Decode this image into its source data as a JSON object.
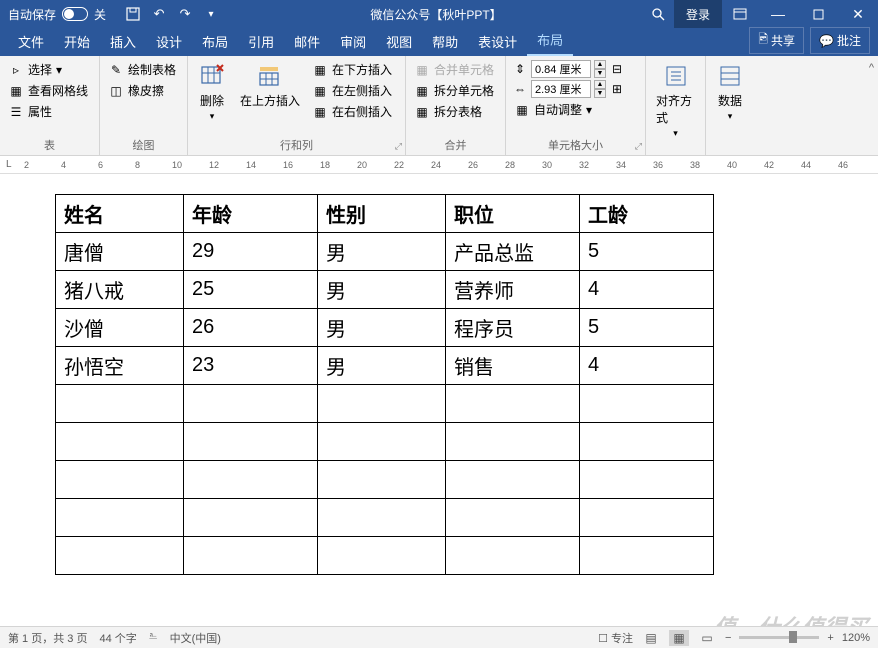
{
  "titlebar": {
    "autosave": "自动保存",
    "autosave_state": "关",
    "title": "微信公众号【秋叶PPT】",
    "login": "登录"
  },
  "tabs": {
    "items": [
      "文件",
      "开始",
      "插入",
      "设计",
      "布局",
      "引用",
      "邮件",
      "审阅",
      "视图",
      "帮助",
      "表设计",
      "布局"
    ],
    "active_index": 11,
    "share": "共享",
    "comments": "批注"
  },
  "ribbon": {
    "group1": {
      "label": "表",
      "select": "选择",
      "gridlines": "查看网格线",
      "properties": "属性"
    },
    "group2": {
      "label": "绘图",
      "draw": "绘制表格",
      "eraser": "橡皮擦"
    },
    "group3": {
      "label": "行和列",
      "delete": "删除",
      "insert_above": "在上方插入",
      "insert_below": "在下方插入",
      "insert_left": "在左侧插入",
      "insert_right": "在右侧插入"
    },
    "group4": {
      "label": "合并",
      "merge": "合并单元格",
      "split_cells": "拆分单元格",
      "split_table": "拆分表格"
    },
    "group5": {
      "label": "单元格大小",
      "height": "0.84 厘米",
      "width": "2.93 厘米",
      "autofit": "自动调整"
    },
    "group6": {
      "label": "",
      "align": "对齐方式"
    },
    "group7": {
      "label": "",
      "data": "数据"
    }
  },
  "ruler": [
    "2",
    "4",
    "6",
    "8",
    "10",
    "12",
    "14",
    "16",
    "18",
    "20",
    "22",
    "24",
    "26",
    "28",
    "30",
    "32",
    "34",
    "36",
    "38",
    "40",
    "42",
    "44",
    "46"
  ],
  "table": {
    "headers": [
      "姓名",
      "年龄",
      "性别",
      "职位",
      "工龄"
    ],
    "rows": [
      [
        "唐僧",
        "29",
        "男",
        "产品总监",
        "5"
      ],
      [
        "猪八戒",
        "25",
        "男",
        "营养师",
        "4"
      ],
      [
        "沙僧",
        "26",
        "男",
        "程序员",
        "5"
      ],
      [
        "孙悟空",
        "23",
        "男",
        "销售",
        "4"
      ],
      [
        "",
        "",
        "",
        "",
        ""
      ],
      [
        "",
        "",
        "",
        "",
        ""
      ],
      [
        "",
        "",
        "",
        "",
        ""
      ],
      [
        "",
        "",
        "",
        "",
        ""
      ],
      [
        "",
        "",
        "",
        "",
        ""
      ]
    ]
  },
  "status": {
    "page": "第 1 页，共 3 页",
    "words": "44 个字",
    "lang": "中文(中国)",
    "focus": "专注",
    "zoom": "120%"
  },
  "watermark": "值，什么值得买"
}
